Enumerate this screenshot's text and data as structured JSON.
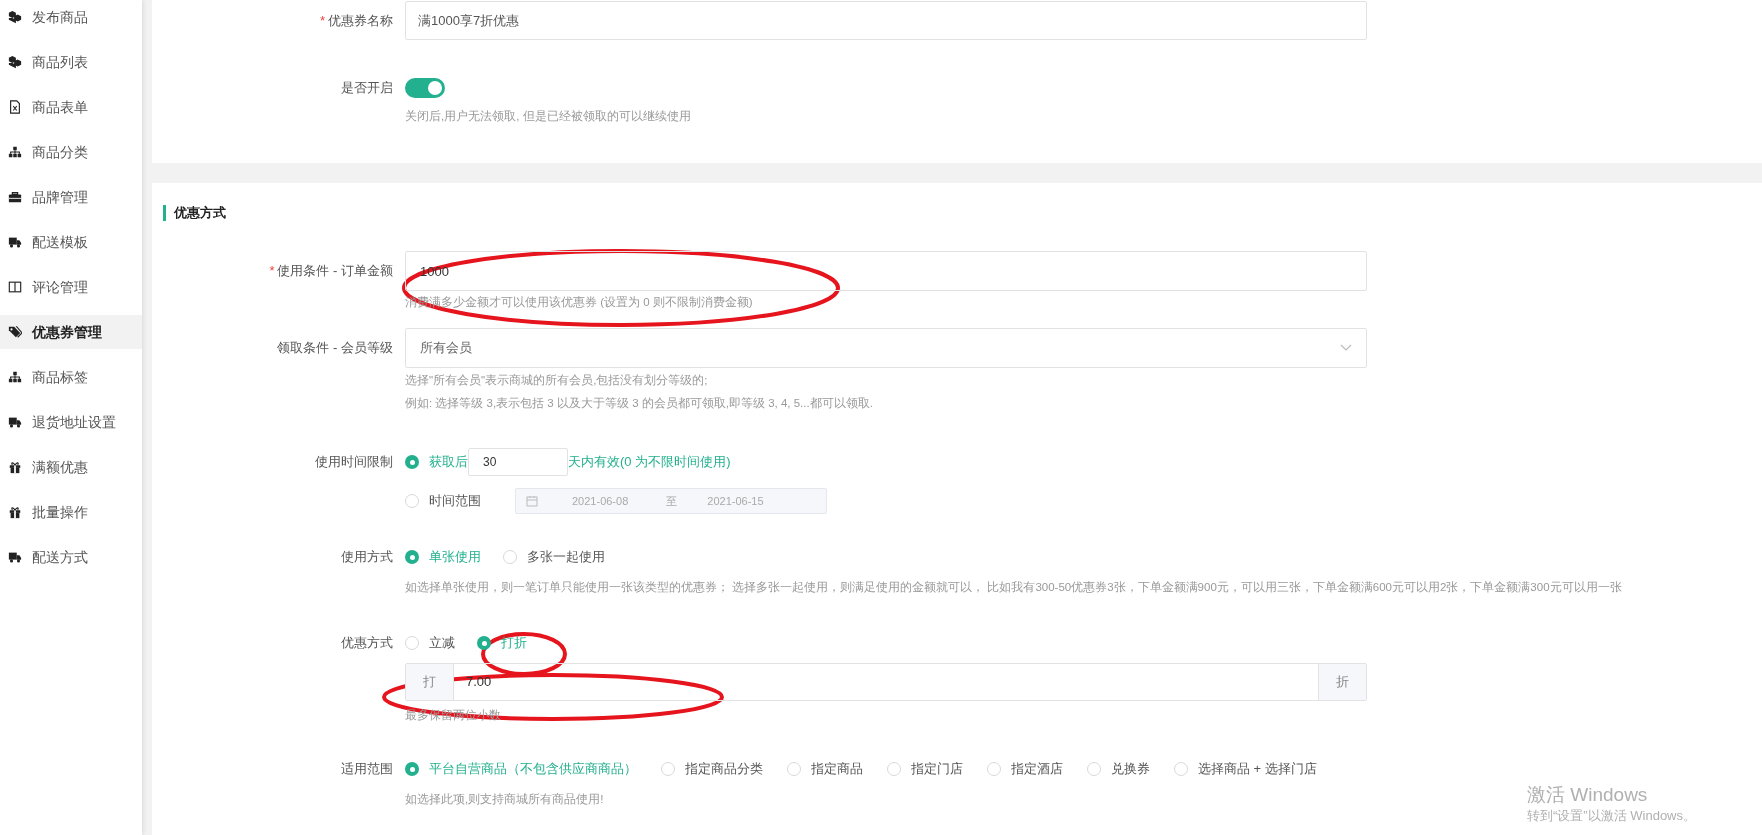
{
  "sidebar": {
    "items": [
      {
        "label": "发布商品",
        "selected": false
      },
      {
        "label": "商品列表",
        "selected": false
      },
      {
        "label": "商品表单",
        "selected": false
      },
      {
        "label": "商品分类",
        "selected": false
      },
      {
        "label": "品牌管理",
        "selected": false
      },
      {
        "label": "配送模板",
        "selected": false
      },
      {
        "label": "评论管理",
        "selected": false
      },
      {
        "label": "优惠券管理",
        "selected": true
      },
      {
        "label": "商品标签",
        "selected": false
      },
      {
        "label": "退货地址设置",
        "selected": false
      },
      {
        "label": "满额优惠",
        "selected": false
      },
      {
        "label": "批量操作",
        "selected": false
      },
      {
        "label": "配送方式",
        "selected": false
      }
    ]
  },
  "coupon_name": {
    "required_mark": "*",
    "label": "优惠券名称",
    "value": "满1000享7折优惠"
  },
  "enabled": {
    "label": "是否开启",
    "on": true,
    "hint": "关闭后,用户无法领取, 但是已经被领取的可以继续使用"
  },
  "discount_section": {
    "title": "优惠方式",
    "order_amount": {
      "required_mark": "*",
      "label": "使用条件 - 订单金额",
      "value": "1000",
      "hint": "消费满多少金额才可以使用该优惠券 (设置为 0 则不限制消费金额)"
    },
    "member_level": {
      "label": "领取条件 - 会员等级",
      "value": "所有会员",
      "hints": [
        "选择\"所有会员\"表示商城的所有会员,包括没有划分等级的;",
        "例如: 选择等级 3,表示包括 3 以及大于等级 3 的会员都可领取,即等级 3, 4, 5...都可以领取."
      ]
    },
    "time_limit": {
      "label": "使用时间限制",
      "options": [
        {
          "kind": "days",
          "selected": true,
          "prefix": "获取后",
          "value": "30",
          "suffix": "天内有效(0 为不限时间使用)"
        },
        {
          "kind": "range",
          "selected": false,
          "label": "时间范围",
          "start": "2021-06-08",
          "separator": "至",
          "end": "2021-06-15"
        }
      ]
    },
    "usage": {
      "label": "使用方式",
      "options": [
        {
          "label": "单张使用",
          "selected": true
        },
        {
          "label": "多张一起使用",
          "selected": false
        }
      ],
      "hint": "如选择单张使用，则一笔订单只能使用一张该类型的优惠券； 选择多张一起使用，则满足使用的金额就可以， 比如我有300-50优惠券3张，下单金额满900元，可以用三张，下单金额满600元可以用2张，下单金额满300元可以用一张"
    },
    "discount_type": {
      "label": "优惠方式",
      "options": [
        {
          "label": "立减",
          "selected": false
        },
        {
          "label": "打折",
          "selected": true
        }
      ],
      "prefix": "打",
      "value": "7.00",
      "suffix": "折",
      "hint": "最多保留两位小数"
    },
    "scope": {
      "label": "适用范围",
      "options": [
        {
          "label": "平台自营商品（不包含供应商商品）",
          "selected": true
        },
        {
          "label": "指定商品分类",
          "selected": false
        },
        {
          "label": "指定商品",
          "selected": false
        },
        {
          "label": "指定门店",
          "selected": false
        },
        {
          "label": "指定酒店",
          "selected": false
        },
        {
          "label": "兑换券",
          "selected": false
        },
        {
          "label": "选择商品 + 选择门店",
          "selected": false
        }
      ],
      "hint": "如选择此项,则支持商城所有商品使用!"
    }
  },
  "os_notice": {
    "title": "激活 Windows",
    "subtitle": "转到“设置”以激活 Windows。"
  }
}
